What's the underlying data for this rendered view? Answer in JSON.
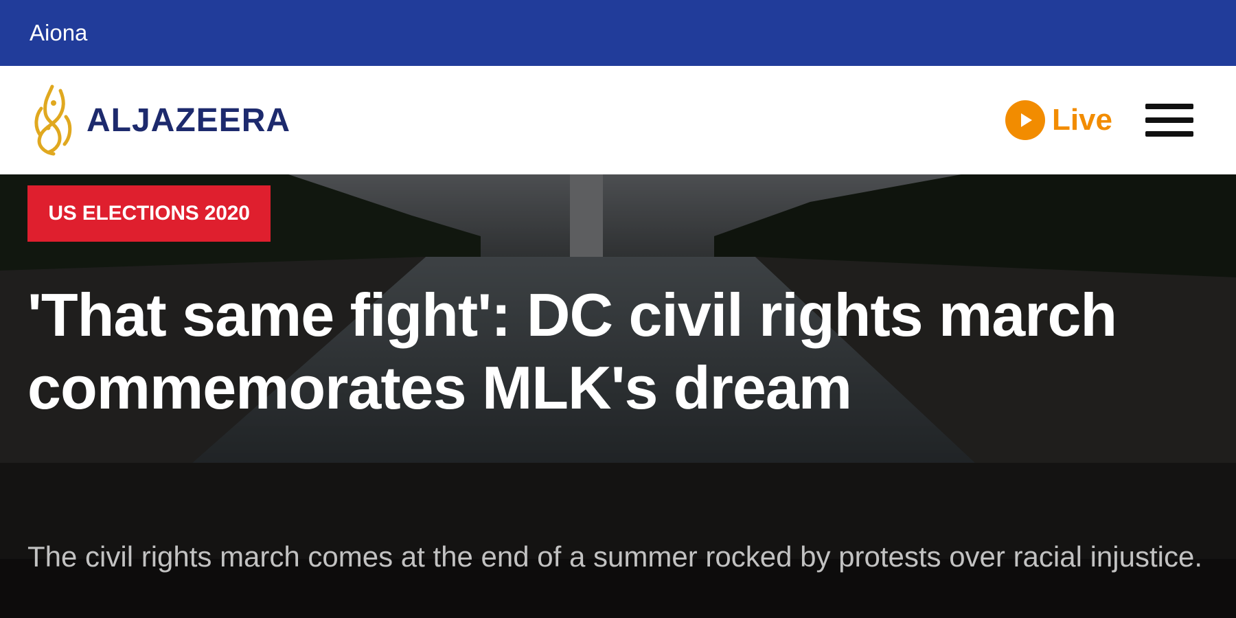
{
  "topbar": {
    "label": "Aiona"
  },
  "header": {
    "logo_text": "ALJAZEERA",
    "live_label": "Live"
  },
  "hero": {
    "category": "US ELECTIONS 2020",
    "headline": "'That same fight': DC civil rights march commemorates MLK's dream",
    "subheadline": "The civil rights march comes at the end of a summer rocked by protests over racial injustice."
  },
  "colors": {
    "topbar": "#213c9a",
    "brand_navy": "#1d2a6d",
    "live_orange": "#f28c00",
    "badge_red": "#df1f2e",
    "logo_gold": "#e0a81f"
  },
  "icons": {
    "logo": "aljazeera-calligraphy-logo-icon",
    "live": "play-circle-icon",
    "menu": "hamburger-menu-icon"
  }
}
